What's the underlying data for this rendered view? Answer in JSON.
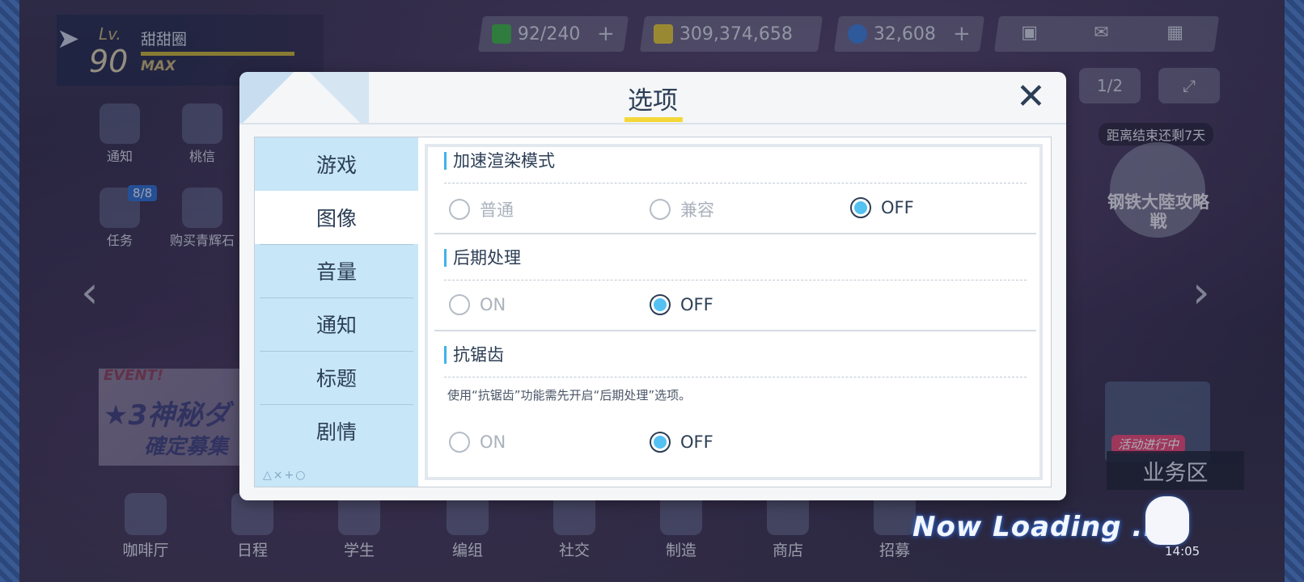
{
  "hud": {
    "player": {
      "lv_label": "Lv.",
      "level": "90",
      "name": "甜甜圈",
      "max_label": "MAX"
    },
    "resources": [
      {
        "name": "stamina",
        "value": "92/240",
        "plus": "+"
      },
      {
        "name": "credits",
        "value": "309,374,658",
        "plus": ""
      },
      {
        "name": "gems",
        "value": "32,608",
        "plus": "+"
      }
    ],
    "side_buttons": {
      "page": "1/2"
    }
  },
  "left_menu": [
    {
      "label": "通知"
    },
    {
      "label": "桃信"
    },
    {
      "label": "任务"
    },
    {
      "label": "购买青辉石"
    }
  ],
  "task_badge": "8/8",
  "event_banner": {
    "tag": "EVENT!",
    "line1": "★3神秘ダ",
    "line2": "確定募集"
  },
  "promo": {
    "countdown": "距离结束还剩7天",
    "title": "钢铁大陸攻略戦"
  },
  "business": {
    "active": "活动进行中",
    "label": "业务区"
  },
  "bottom_nav": [
    {
      "label": "咖啡厅"
    },
    {
      "label": "日程"
    },
    {
      "label": "学生"
    },
    {
      "label": "编组"
    },
    {
      "label": "社交"
    },
    {
      "label": "制造"
    },
    {
      "label": "商店"
    },
    {
      "label": "招募"
    }
  ],
  "loading_text": "Now Loading ...",
  "clock": "14:05",
  "dialog": {
    "title": "选项",
    "close": "✕",
    "tabs": [
      {
        "label": "游戏",
        "selected": false
      },
      {
        "label": "图像",
        "selected": true
      },
      {
        "label": "音量",
        "selected": false
      },
      {
        "label": "通知",
        "selected": false
      },
      {
        "label": "标题",
        "selected": false
      },
      {
        "label": "剧情",
        "selected": false
      }
    ],
    "tab_deco": "△×+○",
    "sections": {
      "accel": {
        "title": "加速渲染模式",
        "options": [
          "普通",
          "兼容",
          "OFF"
        ],
        "selected": "OFF"
      },
      "post": {
        "title": "后期处理",
        "options": [
          "ON",
          "OFF"
        ],
        "selected": "OFF"
      },
      "aa": {
        "title": "抗锯齿",
        "note": "使用“抗锯齿”功能需先开启“后期处理”选项。",
        "options": [
          "ON",
          "OFF"
        ],
        "selected": "OFF"
      }
    }
  },
  "colors": {
    "accent": "#54c1f2",
    "tab_bg": "#c7e6f7",
    "title_underline": "#f4d83a"
  }
}
